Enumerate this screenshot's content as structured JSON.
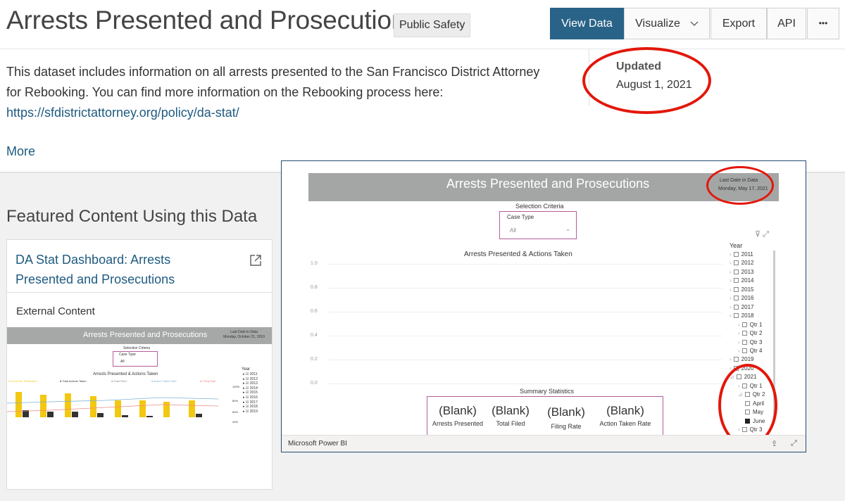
{
  "header": {
    "title": "Arrests Presented and Prosecutions",
    "category": "Public Safety",
    "buttons": {
      "view_data": "View Data",
      "visualize": "Visualize",
      "export": "Export",
      "api": "API",
      "more": "•••"
    }
  },
  "description": {
    "text": "This dataset includes information on all arrests presented to the San Francisco District Attorney for Rebooking. You can find more information on the Rebooking process here:",
    "link": "https://sfdistrictattorney.org/policy/da-stat/",
    "more": "More"
  },
  "updated": {
    "label": "Updated",
    "value": "August 1, 2021"
  },
  "featured": {
    "heading": "Featured Content Using this Data",
    "card": {
      "title": "DA Stat Dashboard: Arrests Presented and Prosecutions",
      "type": "External Content",
      "thumb": {
        "title": "Arrests Presented and Prosecutions",
        "date_label": "Last Date in Data",
        "date_value": "Monday, October 21, 2019",
        "selection_criteria": "Selection Criteria",
        "case_type": "Case Type",
        "case_value": "All",
        "chart_title": "Arrests Presented & Actions Taken",
        "legend": [
          "Court No. Presented",
          "Total Actions Taken",
          "Total Filed",
          "Action Taken Rate",
          "Filing Rate"
        ],
        "years_head": "Year",
        "years": [
          "2011",
          "2012",
          "2013",
          "2014",
          "2015",
          "2016",
          "2017",
          "2018",
          "2019"
        ]
      }
    }
  },
  "embed": {
    "title": "Arrests Presented and Prosecutions",
    "date_label": "Last Date in Data",
    "date_value": "Monday, May 17, 2021",
    "selection_criteria": "Selection Criteria",
    "case_type": "Case Type",
    "case_value": "All",
    "chart_title": "Arrests Presented & Actions Taken",
    "yticks": [
      "1.0",
      "0.8",
      "0.6",
      "0.4",
      "0.2",
      "0.0"
    ],
    "summary_title": "Summary Statistics",
    "summary": [
      {
        "value": "(Blank)",
        "label": "Arrests Presented"
      },
      {
        "value": "(Blank)",
        "label": "Total Filed"
      },
      {
        "value": "(Blank)",
        "label": "Filing Rate"
      },
      {
        "value": "(Blank)",
        "label": "Action Taken Rate"
      }
    ],
    "year_head": "Year",
    "years": [
      "2011",
      "2012",
      "2013",
      "2014",
      "2015",
      "2016",
      "2017",
      "2018"
    ],
    "quarters_2018": [
      "Qtr 1",
      "Qtr 2",
      "Qtr 3",
      "Qtr 4"
    ],
    "years_b": [
      "2019",
      "2020",
      "2021"
    ],
    "quarters_2021": [
      "Qtr 1",
      "Qtr 2"
    ],
    "months": [
      "April",
      "May",
      "June"
    ],
    "quarter_next": "Qtr 3",
    "footer": "Microsoft Power BI"
  },
  "colors": {
    "primary": "#2a6388",
    "link": "#1e5a80",
    "highlight": "#e3170a",
    "pbi_band": "#a4a6a6",
    "slicer_border": "#b45d9c"
  }
}
